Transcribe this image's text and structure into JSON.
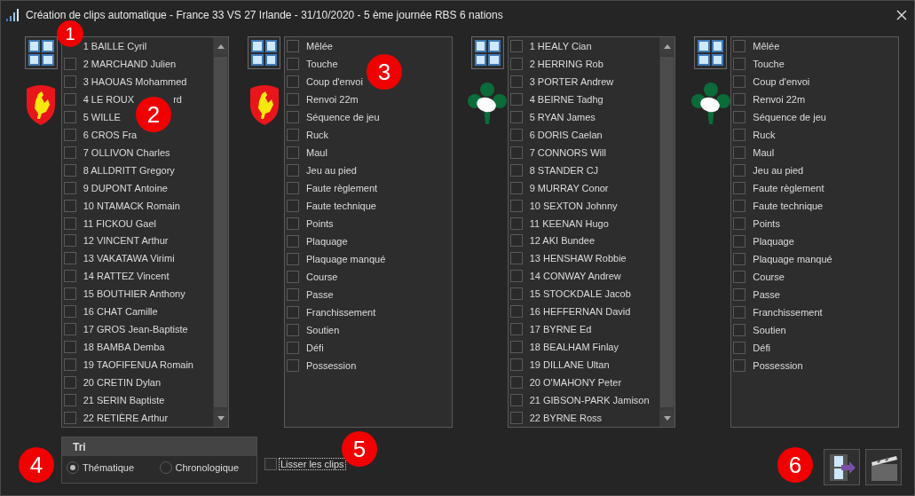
{
  "window": {
    "title": "Création de clips automatique - France 33 VS 27 Irlande - 31/10/2020 - 5 ème journée RBS 6 nations"
  },
  "panels": [
    {
      "kind": "players",
      "logo": {
        "kind": "rooster"
      },
      "items": [
        {
          "label": "1 BAILLE Cyril"
        },
        {
          "label": "2 MARCHAND Julien",
          "checked": false
        },
        {
          "label": "3 HAOUAS Mohammed",
          "checked": false
        },
        {
          "label": "4 LE ROUX",
          "tail": "rd",
          "checked": false
        },
        {
          "label": "5 WILLE",
          "checked": false
        },
        {
          "label": "6 CROS Fra",
          "checked": false
        },
        {
          "label": "7 OLLIVON Charles",
          "checked": false
        },
        {
          "label": "8 ALLDRITT Gregory",
          "checked": false
        },
        {
          "label": "9 DUPONT Antoine",
          "checked": false
        },
        {
          "label": "10 NTAMACK Romain",
          "checked": false
        },
        {
          "label": "11 FICKOU Gael",
          "checked": false
        },
        {
          "label": "12 VINCENT Arthur",
          "checked": false
        },
        {
          "label": "13 VAKATAWA Virimi",
          "checked": false
        },
        {
          "label": "14 RATTEZ Vincent",
          "checked": false
        },
        {
          "label": "15 BOUTHIER Anthony",
          "checked": false
        },
        {
          "label": "16 CHAT Camille",
          "checked": false
        },
        {
          "label": "17 GROS Jean-Baptiste",
          "checked": false
        },
        {
          "label": "18 BAMBA Demba",
          "checked": false
        },
        {
          "label": "19 TAOFIFENUA Romain",
          "checked": false
        },
        {
          "label": "20 CRETIN Dylan",
          "checked": false
        },
        {
          "label": "21 SERIN Baptiste",
          "checked": false
        },
        {
          "label": "22 RETIÈRE Arthur",
          "checked": false
        }
      ]
    },
    {
      "kind": "actions",
      "logo": {
        "kind": "rooster"
      },
      "items": [
        {
          "label": "Mêlée",
          "checked": false
        },
        {
          "label": "Touche",
          "checked": false
        },
        {
          "label": "Coup d'envoi",
          "checked": false
        },
        {
          "label": "Renvoi 22m",
          "checked": false
        },
        {
          "label": "Séquence de jeu",
          "checked": false
        },
        {
          "label": "Ruck",
          "checked": false
        },
        {
          "label": "Maul",
          "checked": false
        },
        {
          "label": "Jeu au pied",
          "checked": false
        },
        {
          "label": "Faute règlement",
          "checked": false
        },
        {
          "label": "Faute technique",
          "checked": false
        },
        {
          "label": "Points",
          "checked": false
        },
        {
          "label": "Plaquage",
          "checked": false
        },
        {
          "label": "Plaquage manqué",
          "checked": false
        },
        {
          "label": "Course",
          "checked": false
        },
        {
          "label": "Passe",
          "checked": false
        },
        {
          "label": "Franchissement",
          "checked": false
        },
        {
          "label": "Soutien",
          "checked": false
        },
        {
          "label": "Défi",
          "checked": false
        },
        {
          "label": "Possession",
          "checked": false
        }
      ]
    },
    {
      "kind": "players",
      "logo": {
        "kind": "shamrock"
      },
      "items": [
        {
          "label": "1 HEALY Cian",
          "checked": false
        },
        {
          "label": "2 HERRING Rob",
          "checked": false
        },
        {
          "label": "3 PORTER Andrew",
          "checked": false
        },
        {
          "label": "4 BEIRNE Tadhg",
          "checked": false
        },
        {
          "label": "5 RYAN James",
          "checked": false
        },
        {
          "label": "6 DORIS Caelan",
          "checked": false
        },
        {
          "label": "7 CONNORS Will",
          "checked": false
        },
        {
          "label": "8 STANDER CJ",
          "checked": false
        },
        {
          "label": "9 MURRAY Conor",
          "checked": false
        },
        {
          "label": "10 SEXTON Johnny",
          "checked": false
        },
        {
          "label": "11 KEENAN Hugo",
          "checked": false
        },
        {
          "label": "12 AKI Bundee",
          "checked": false
        },
        {
          "label": "13 HENSHAW Robbie",
          "checked": false
        },
        {
          "label": "14 CONWAY Andrew",
          "checked": false
        },
        {
          "label": "15 STOCKDALE Jacob",
          "checked": false
        },
        {
          "label": "16 HEFFERNAN David",
          "checked": false
        },
        {
          "label": "17 BYRNE Ed",
          "checked": false
        },
        {
          "label": "18 BEALHAM Finlay",
          "checked": false
        },
        {
          "label": "19 DILLANE Ultan",
          "checked": false
        },
        {
          "label": "20 O'MAHONY Peter",
          "checked": false
        },
        {
          "label": "21 GIBSON-PARK Jamison",
          "checked": false
        },
        {
          "label": "22 BYRNE Ross",
          "checked": false
        }
      ]
    },
    {
      "kind": "actions",
      "logo": {
        "kind": "shamrock"
      },
      "items": [
        {
          "label": "Mêlée",
          "checked": false
        },
        {
          "label": "Touche",
          "checked": false
        },
        {
          "label": "Coup d'envoi",
          "checked": false
        },
        {
          "label": "Renvoi 22m",
          "checked": false
        },
        {
          "label": "Séquence de jeu",
          "checked": false
        },
        {
          "label": "Ruck",
          "checked": false
        },
        {
          "label": "Maul",
          "checked": false
        },
        {
          "label": "Jeu au pied",
          "checked": false
        },
        {
          "label": "Faute règlement",
          "checked": false
        },
        {
          "label": "Faute technique",
          "checked": false
        },
        {
          "label": "Points",
          "checked": false
        },
        {
          "label": "Plaquage",
          "checked": false
        },
        {
          "label": "Plaquage manqué",
          "checked": false
        },
        {
          "label": "Course",
          "checked": false
        },
        {
          "label": "Passe",
          "checked": false
        },
        {
          "label": "Franchissement",
          "checked": false
        },
        {
          "label": "Soutien",
          "checked": false
        },
        {
          "label": "Défi",
          "checked": false
        },
        {
          "label": "Possession",
          "checked": false
        }
      ]
    }
  ],
  "sort": {
    "title": "Tri",
    "options": [
      {
        "label": "Thématique",
        "selected": true
      },
      {
        "label": "Chronologique",
        "selected": false
      }
    ]
  },
  "smooth": {
    "label": "Lisser les clips",
    "checked": false
  },
  "markers": [
    {
      "label": "1"
    },
    {
      "label": "2"
    },
    {
      "label": "3"
    },
    {
      "label": "4"
    },
    {
      "label": "5"
    },
    {
      "label": "6"
    }
  ]
}
